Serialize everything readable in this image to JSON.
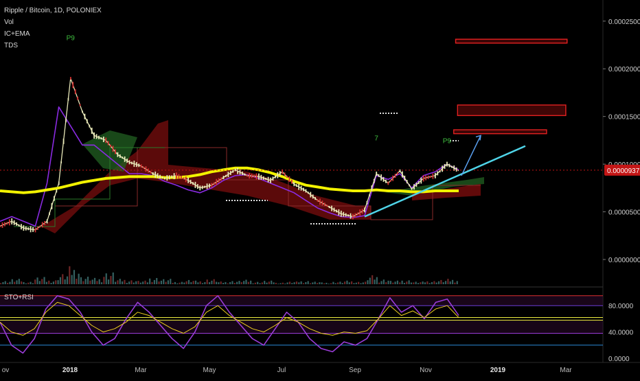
{
  "header": {
    "symbol_line": "Ripple / Bitcoin, 1D, POLONIEX",
    "indicators": [
      "Vol",
      "IC+EMA",
      "TDS"
    ]
  },
  "colors": {
    "background": "#000000",
    "candle_up": "#e8e8b8",
    "candle_down": "#d23030",
    "ema_yellow": "#f2f200",
    "purple_line": "#8a2be2",
    "cyan_line": "#1fc8e8",
    "cloud_red": "#7a0d0d",
    "cloud_green": "#1f5a1f",
    "volume": "#3a6a6a",
    "resistance_box": "#e02020",
    "current_price_bg": "#c41616",
    "stoch_k": "#9a3cd8",
    "rsi": "#f0d020"
  },
  "chart_data": [
    {
      "type": "line",
      "title": "Ripple / Bitcoin, 1D, POLONIEX",
      "x_axis_labels": [
        "ov",
        "2018",
        "Mar",
        "May",
        "Jul",
        "Sep",
        "Nov",
        "2019",
        "Mar"
      ],
      "y_axis_labels": [
        "0.00025000",
        "0.00020000",
        "0.00015000",
        "0.00010000",
        "0.00005000",
        "0.00000000"
      ],
      "ylim": [
        0,
        0.00027
      ],
      "current_price_label": "0.00009371",
      "current_price": 9.371e-05,
      "series": [
        {
          "values": [
            3.5e-05,
            4e-05,
            3.3e-05,
            3.1e-05,
            4e-05,
            8e-05,
            0.00019,
            0.000155,
            0.00013,
            0.000125,
            0.00011,
            0.000102,
            9.8e-05,
            9e-05,
            8.5e-05,
            8.8e-05,
            8.3e-05,
            7.5e-05,
            7.8e-05,
            8.6e-05,
            9.4e-05,
            8.8e-05,
            8.7e-05,
            8.3e-05,
            9.2e-05,
            7.9e-05,
            7.2e-05,
            6.2e-05,
            5.5e-05,
            4.8e-05,
            4.5e-05,
            5.2e-05,
            9e-05,
            8e-05,
            9.3e-05,
            7.4e-05,
            8.5e-05,
            8.8e-05,
            0.0001,
            9.3e-05
          ]
        },
        {
          "values": [
            7.2e-05,
            7.1e-05,
            7e-05,
            7.1e-05,
            7.3e-05,
            7.5e-05,
            7.8e-05,
            8.1e-05,
            8.3e-05,
            8.5e-05,
            8.6e-05,
            8.7e-05,
            8.7e-05,
            8.7e-05,
            8.6e-05,
            8.6e-05,
            8.7e-05,
            8.9e-05,
            9.2e-05,
            9.4e-05,
            9.6e-05,
            9.6e-05,
            9.4e-05,
            9.1e-05,
            8.7e-05,
            8.2e-05,
            7.8e-05,
            7.6e-05,
            7.4e-05,
            7.3e-05,
            7.2e-05,
            7.2e-05,
            7.3e-05,
            7.2e-05,
            7.2e-05,
            7.1e-05,
            7.1e-05,
            7.2e-05,
            7.2e-05,
            7.2e-05
          ]
        },
        {
          "values": [
            4e-05,
            4.5e-05,
            4e-05,
            3.5e-05,
            8e-05,
            0.00016,
            0.00014,
            0.00012,
            0.00012,
            0.00011,
            0.0001,
            9e-05,
            9e-05,
            8.8e-05,
            8.2e-05,
            7.8e-05,
            7.3e-05,
            7e-05,
            7.5e-05,
            8.3e-05,
            8.8e-05,
            8.9e-05,
            8.5e-05,
            8e-05,
            7.5e-05,
            7e-05,
            6.2e-05,
            5.4e-05,
            4.9e-05,
            4.5e-05,
            4.4e-05,
            4.6e-05,
            8.8e-05,
            8.4e-05,
            9e-05,
            7.5e-05,
            8.8e-05,
            9.2e-05,
            0.0001,
            9.4e-05
          ]
        }
      ],
      "annotations": [
        {
          "text": "P9",
          "x_index": 6,
          "y": 0.00023
        },
        {
          "text": "7",
          "x_index": 32,
          "y": 0.000125
        },
        {
          "text": "P9",
          "x_index": 38,
          "y": 0.000122
        }
      ],
      "resistance_zones": [
        {
          "low": 0.000227,
          "high": 0.000231,
          "x_start": 0.712,
          "x_end": 0.886
        },
        {
          "low": 0.000151,
          "high": 0.000162,
          "x_start": 0.715,
          "x_end": 0.884
        },
        {
          "low": 0.000132,
          "high": 0.000136,
          "x_start": 0.709,
          "x_end": 0.854
        }
      ],
      "trendline": {
        "from_index": 31,
        "from_value": 4.5e-05,
        "to_value": 0.000119
      },
      "arrow": {
        "from_value": 8.8e-05,
        "to_value": 0.00013
      }
    },
    {
      "type": "line",
      "title": "STO+RSI",
      "y_axis_labels": [
        "80.0000",
        "40.0000",
        "0.0000"
      ],
      "ylim": [
        0,
        100
      ],
      "levels": [
        {
          "value": 95,
          "color": "#e03030"
        },
        {
          "value": 80,
          "color": "#6a3cd8"
        },
        {
          "value": 62,
          "color": "#f0f040"
        },
        {
          "value": 58,
          "color": "#f0f040"
        },
        {
          "value": 38,
          "color": "#9a3cd8"
        },
        {
          "value": 20,
          "color": "#2a8ad8"
        }
      ],
      "series": [
        {
          "values": [
            55,
            20,
            8,
            30,
            75,
            95,
            90,
            70,
            40,
            20,
            30,
            60,
            85,
            70,
            50,
            30,
            15,
            40,
            80,
            95,
            70,
            50,
            30,
            20,
            45,
            70,
            55,
            30,
            15,
            10,
            25,
            20,
            30,
            60,
            92,
            70,
            80,
            60,
            85,
            90,
            65
          ]
        },
        {
          "values": [
            55,
            40,
            35,
            45,
            70,
            85,
            80,
            65,
            50,
            40,
            45,
            55,
            70,
            65,
            55,
            45,
            38,
            48,
            70,
            80,
            65,
            55,
            45,
            40,
            50,
            62,
            55,
            45,
            38,
            35,
            40,
            38,
            42,
            60,
            80,
            65,
            72,
            62,
            75,
            80,
            62
          ]
        }
      ]
    }
  ]
}
